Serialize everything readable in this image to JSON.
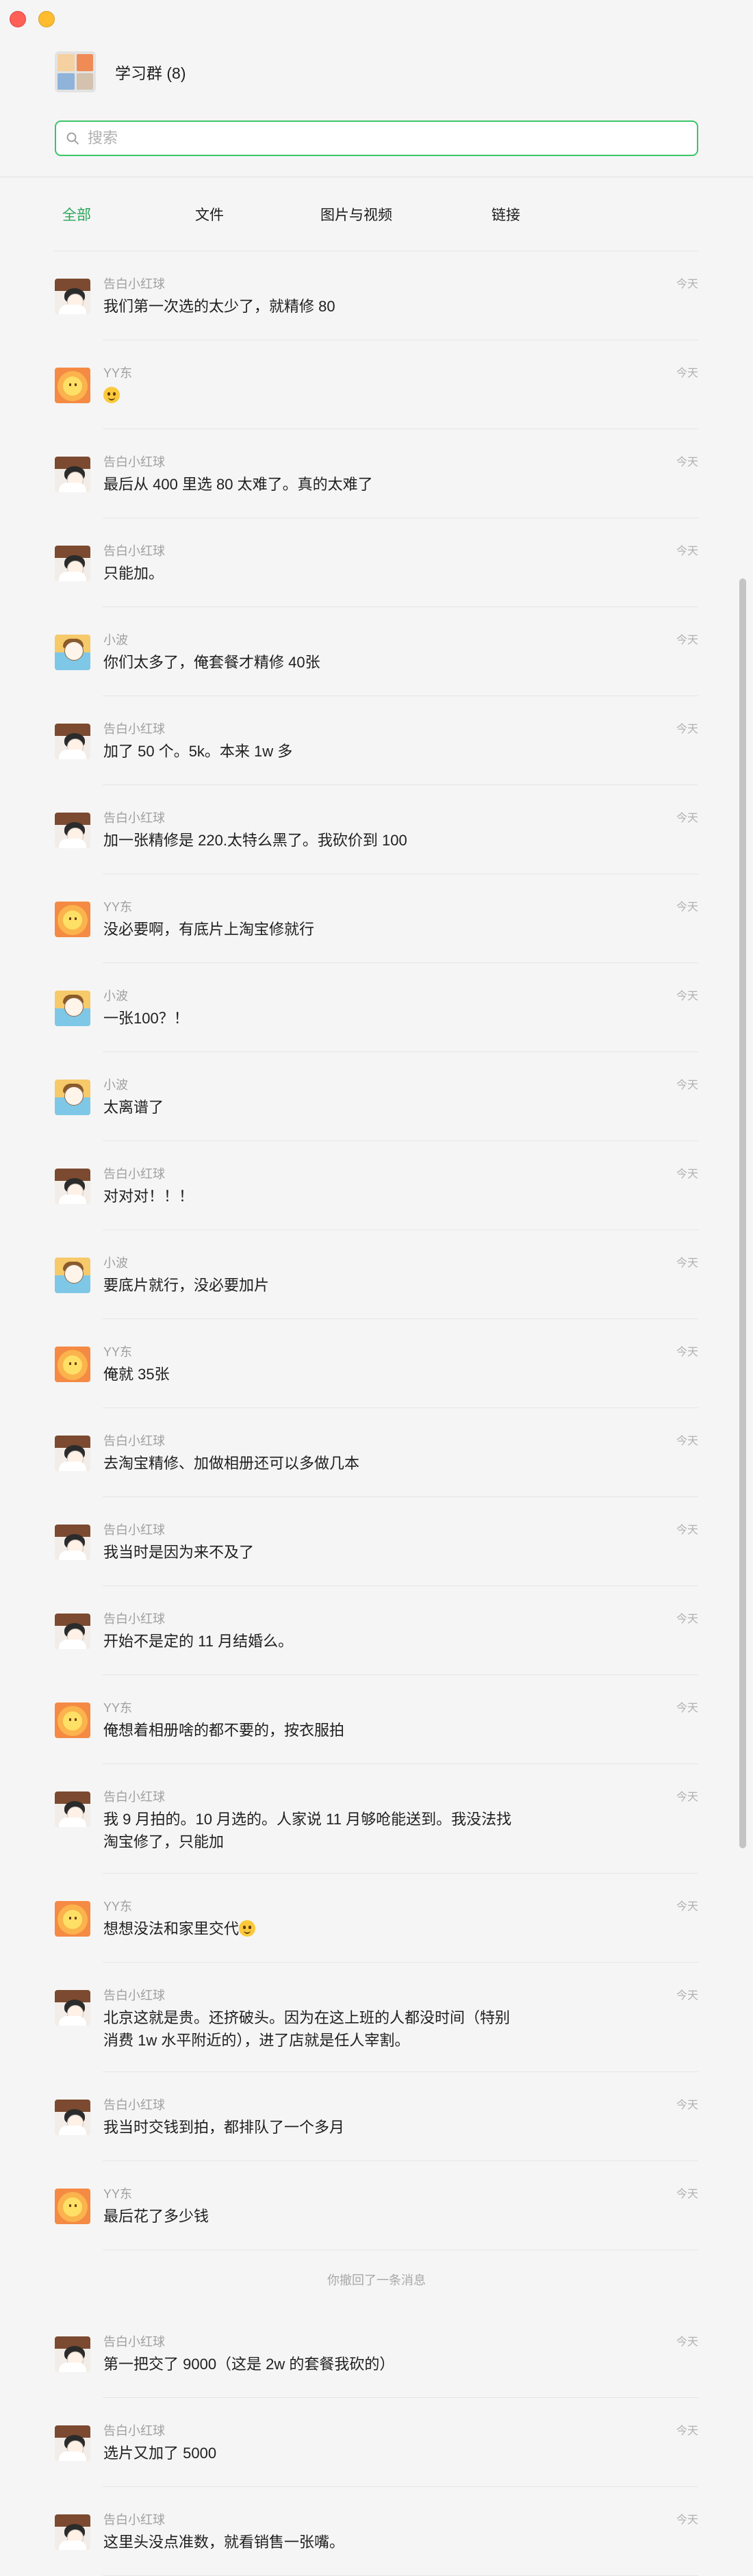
{
  "group": {
    "title": "学习群 (8)"
  },
  "search": {
    "placeholder": "搜索"
  },
  "tabs": [
    {
      "label": "全部"
    },
    {
      "label": "文件"
    },
    {
      "label": "图片与视频"
    },
    {
      "label": "链接"
    }
  ],
  "avatars": {
    "告白小红球": "hong",
    "YY东": "yy",
    "小波": "bo"
  },
  "messages": [
    {
      "sender": "告白小红球",
      "time": "今天",
      "text": "我们第一次选的太少了，就精修 80"
    },
    {
      "sender": "YY东",
      "time": "今天",
      "text": "",
      "emoji": true
    },
    {
      "sender": "告白小红球",
      "time": "今天",
      "text": "最后从 400 里选 80 太难了。真的太难了"
    },
    {
      "sender": "告白小红球",
      "time": "今天",
      "text": "只能加。"
    },
    {
      "sender": "小波",
      "time": "今天",
      "text": "你们太多了，俺套餐才精修 40张"
    },
    {
      "sender": "告白小红球",
      "time": "今天",
      "text": "加了 50 个。5k。本来 1w 多"
    },
    {
      "sender": "告白小红球",
      "time": "今天",
      "text": "加一张精修是 220.太特么黑了。我砍价到 100"
    },
    {
      "sender": "YY东",
      "time": "今天",
      "text": "没必要啊，有底片上淘宝修就行"
    },
    {
      "sender": "小波",
      "time": "今天",
      "text": "一张100？！"
    },
    {
      "sender": "小波",
      "time": "今天",
      "text": "太离谱了"
    },
    {
      "sender": "告白小红球",
      "time": "今天",
      "text": "对对对！！！"
    },
    {
      "sender": "小波",
      "time": "今天",
      "text": "要底片就行，没必要加片"
    },
    {
      "sender": "YY东",
      "time": "今天",
      "text": "俺就 35张"
    },
    {
      "sender": "告白小红球",
      "time": "今天",
      "text": "去淘宝精修、加做相册还可以多做几本"
    },
    {
      "sender": "告白小红球",
      "time": "今天",
      "text": "我当时是因为来不及了"
    },
    {
      "sender": "告白小红球",
      "time": "今天",
      "text": "开始不是定的 11 月结婚么。"
    },
    {
      "sender": "YY东",
      "time": "今天",
      "text": "俺想着相册啥的都不要的，按衣服拍"
    },
    {
      "sender": "告白小红球",
      "time": "今天",
      "text": "我 9 月拍的。10 月选的。人家说 11 月够呛能送到。我没法找淘宝修了，只能加",
      "lines": 2
    },
    {
      "sender": "YY东",
      "time": "今天",
      "text": "想想没法和家里交代",
      "emoji": true
    },
    {
      "sender": "告白小红球",
      "time": "今天",
      "text": "北京这就是贵。还挤破头。因为在这上班的人都没时间（特别消费 1w 水平附近的），进了店就是任人宰割。",
      "lines": 2
    },
    {
      "sender": "告白小红球",
      "time": "今天",
      "text": "我当时交钱到拍，都排队了一个多月"
    },
    {
      "sender": "YY东",
      "time": "今天",
      "text": "最后花了多少钱"
    },
    {
      "system": true,
      "text": "你撤回了一条消息"
    },
    {
      "sender": "告白小红球",
      "time": "今天",
      "text": "第一把交了 9000（这是 2w 的套餐我砍的）"
    },
    {
      "sender": "告白小红球",
      "time": "今天",
      "text": "选片又加了 5000"
    },
    {
      "sender": "告白小红球",
      "time": "今天",
      "text": "这里头没点准数，就看销售一张嘴。"
    }
  ]
}
